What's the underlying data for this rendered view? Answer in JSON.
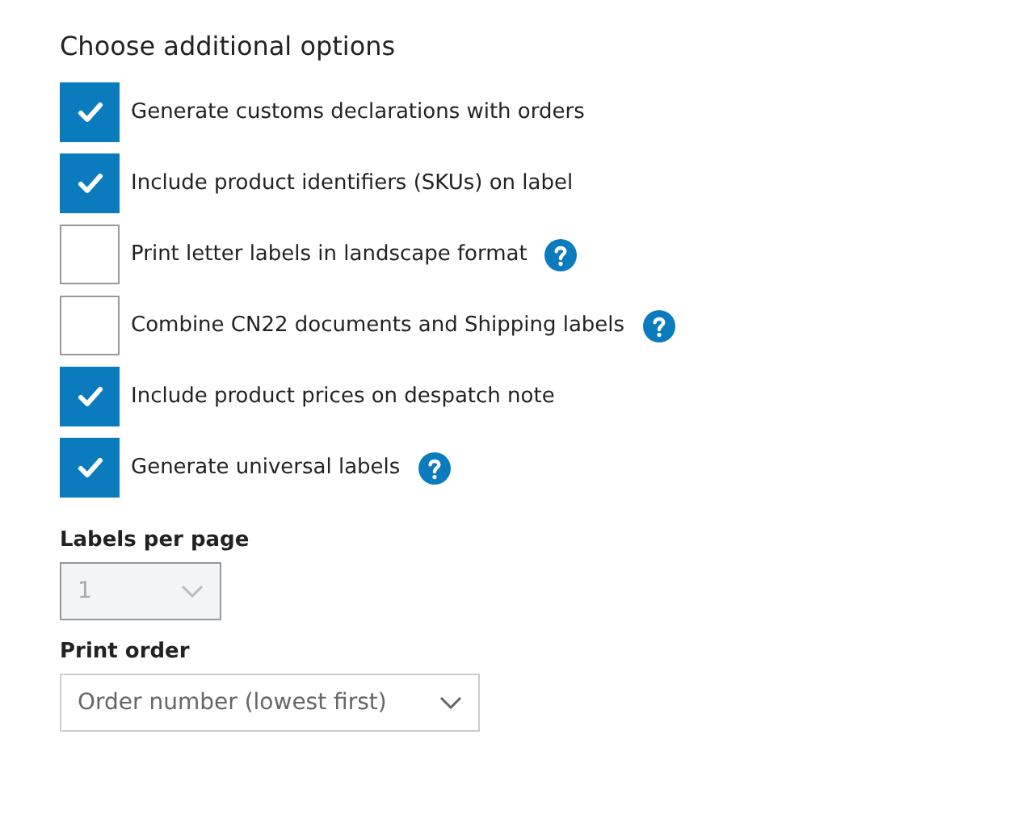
{
  "heading": "Choose additional options",
  "options": [
    {
      "label": "Generate customs declarations with orders",
      "checked": true,
      "help": false
    },
    {
      "label": "Include product identifiers (SKUs) on label",
      "checked": true,
      "help": false
    },
    {
      "label": "Print letter labels in landscape format",
      "checked": false,
      "help": true
    },
    {
      "label": "Combine CN22 documents and Shipping labels",
      "checked": false,
      "help": true
    },
    {
      "label": "Include product prices on despatch note",
      "checked": true,
      "help": false
    },
    {
      "label": "Generate universal labels",
      "checked": true,
      "help": true
    }
  ],
  "selects": [
    {
      "label": "Labels per page",
      "value": "1",
      "disabled": true
    },
    {
      "label": "Print order",
      "value": "Order number (lowest first)",
      "disabled": false
    }
  ]
}
